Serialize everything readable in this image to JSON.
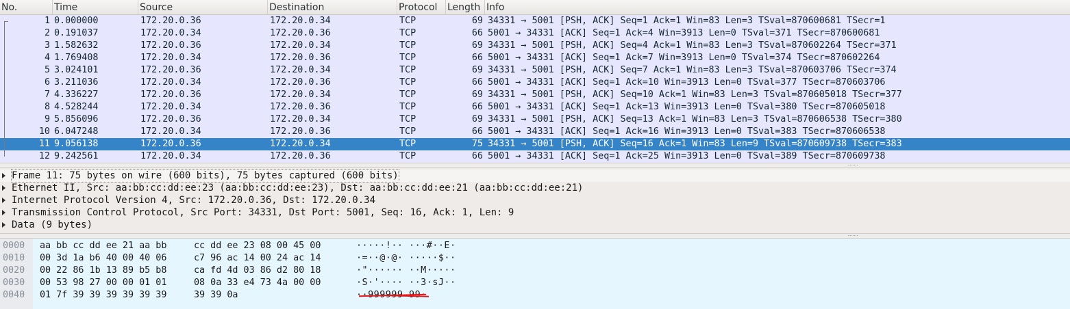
{
  "columns": [
    "No.",
    "Time",
    "Source",
    "Destination",
    "Protocol",
    "Length",
    "Info"
  ],
  "packets": [
    {
      "no": "1",
      "time": "0.000000",
      "src": "172.20.0.36",
      "dst": "172.20.0.34",
      "proto": "TCP",
      "len": "69",
      "info": "34331 → 5001 [PSH, ACK] Seq=1 Ack=1 Win=83 Len=3 TSval=870600681 TSecr=1"
    },
    {
      "no": "2",
      "time": "0.191037",
      "src": "172.20.0.34",
      "dst": "172.20.0.36",
      "proto": "TCP",
      "len": "66",
      "info": "5001 → 34331 [ACK] Seq=1 Ack=4 Win=3913 Len=0 TSval=371 TSecr=870600681"
    },
    {
      "no": "3",
      "time": "1.582632",
      "src": "172.20.0.36",
      "dst": "172.20.0.34",
      "proto": "TCP",
      "len": "69",
      "info": "34331 → 5001 [PSH, ACK] Seq=4 Ack=1 Win=83 Len=3 TSval=870602264 TSecr=371"
    },
    {
      "no": "4",
      "time": "1.769408",
      "src": "172.20.0.34",
      "dst": "172.20.0.36",
      "proto": "TCP",
      "len": "66",
      "info": "5001 → 34331 [ACK] Seq=1 Ack=7 Win=3913 Len=0 TSval=374 TSecr=870602264"
    },
    {
      "no": "5",
      "time": "3.024101",
      "src": "172.20.0.36",
      "dst": "172.20.0.34",
      "proto": "TCP",
      "len": "69",
      "info": "34331 → 5001 [PSH, ACK] Seq=7 Ack=1 Win=83 Len=3 TSval=870603706 TSecr=374"
    },
    {
      "no": "6",
      "time": "3.211036",
      "src": "172.20.0.34",
      "dst": "172.20.0.36",
      "proto": "TCP",
      "len": "66",
      "info": "5001 → 34331 [ACK] Seq=1 Ack=10 Win=3913 Len=0 TSval=377 TSecr=870603706"
    },
    {
      "no": "7",
      "time": "4.336227",
      "src": "172.20.0.36",
      "dst": "172.20.0.34",
      "proto": "TCP",
      "len": "69",
      "info": "34331 → 5001 [PSH, ACK] Seq=10 Ack=1 Win=83 Len=3 TSval=870605018 TSecr=377"
    },
    {
      "no": "8",
      "time": "4.528244",
      "src": "172.20.0.34",
      "dst": "172.20.0.36",
      "proto": "TCP",
      "len": "66",
      "info": "5001 → 34331 [ACK] Seq=1 Ack=13 Win=3913 Len=0 TSval=380 TSecr=870605018"
    },
    {
      "no": "9",
      "time": "5.856096",
      "src": "172.20.0.36",
      "dst": "172.20.0.34",
      "proto": "TCP",
      "len": "69",
      "info": "34331 → 5001 [PSH, ACK] Seq=13 Ack=1 Win=83 Len=3 TSval=870606538 TSecr=380"
    },
    {
      "no": "10",
      "time": "6.047248",
      "src": "172.20.0.34",
      "dst": "172.20.0.36",
      "proto": "TCP",
      "len": "66",
      "info": "5001 → 34331 [ACK] Seq=1 Ack=16 Win=3913 Len=0 TSval=383 TSecr=870606538"
    },
    {
      "no": "11",
      "time": "9.056138",
      "src": "172.20.0.36",
      "dst": "172.20.0.34",
      "proto": "TCP",
      "len": "75",
      "info": "34331 → 5001 [PSH, ACK] Seq=16 Ack=1 Win=83 Len=9 TSval=870609738 TSecr=383",
      "selected": true
    },
    {
      "no": "12",
      "time": "9.242561",
      "src": "172.20.0.34",
      "dst": "172.20.0.36",
      "proto": "TCP",
      "len": "66",
      "info": "5001 → 34331 [ACK] Seq=1 Ack=25 Win=3913 Len=0 TSval=389 TSecr=870609738"
    }
  ],
  "details": [
    "Frame 11: 75 bytes on wire (600 bits), 75 bytes captured (600 bits)",
    "Ethernet II, Src: aa:bb:cc:dd:ee:23 (aa:bb:cc:dd:ee:23), Dst: aa:bb:cc:dd:ee:21 (aa:bb:cc:dd:ee:21)",
    "Internet Protocol Version 4, Src: 172.20.0.36, Dst: 172.20.0.34",
    "Transmission Control Protocol, Src Port: 34331, Dst Port: 5001, Seq: 16, Ack: 1, Len: 9",
    "Data (9 bytes)"
  ],
  "bytes": [
    {
      "offset": "0000",
      "hex1": "aa bb cc dd ee 21 aa bb",
      "hex2": "cc dd ee 23 08 00 45 00",
      "ascii": "·····!·· ···#··E·"
    },
    {
      "offset": "0010",
      "hex1": "00 3d 1a b6 40 00 40 06",
      "hex2": "c7 96 ac 14 00 24 ac 14",
      "ascii": "·=··@·@· ·····$··"
    },
    {
      "offset": "0020",
      "hex1": "00 22 86 1b 13 89 b5 b8",
      "hex2": "ca fd 4d 03 86 d2 80 18",
      "ascii": "·\"······ ··M·····"
    },
    {
      "offset": "0030",
      "hex1": "00 53 98 27 00 00 01 01",
      "hex2": "08 0a 33 e4 73 4a 00 00",
      "ascii": "·S·'···· ··3·sJ··"
    },
    {
      "offset": "0040",
      "hex1": "01 7f 39 39 39 39 39 39",
      "hex2": "39 39 0a",
      "ascii": "··999999 99·"
    }
  ],
  "colors": {
    "row_bg": "#e7e6ff",
    "selected_bg": "#3584c8",
    "details_bg": "#eeebe8",
    "bytes_bg": "#e6f6ff",
    "annotation": "#e0191b"
  }
}
